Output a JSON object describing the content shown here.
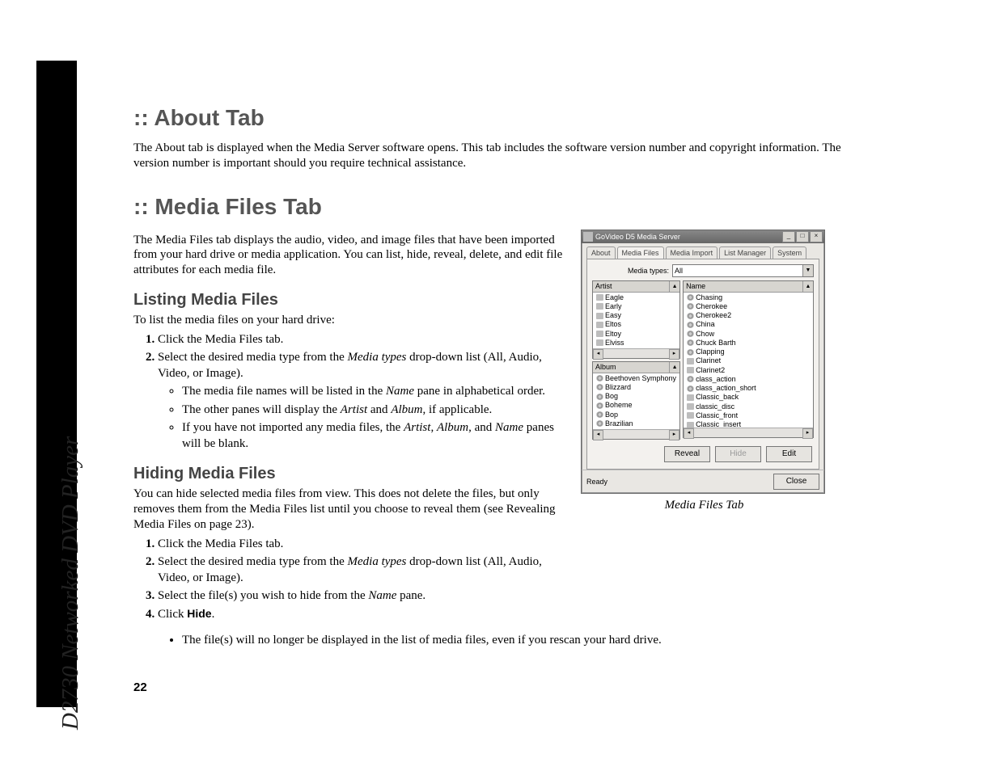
{
  "sidebar_title": "D2730 Networked DVD Player",
  "page_number": "22",
  "sections": {
    "about": {
      "heading": ":: About Tab",
      "paragraph": "The About tab is displayed when the Media Server software opens. This tab includes the software version number and copyright information. The version number is important should you require technical assistance."
    },
    "media_files": {
      "heading": ":: Media Files Tab",
      "intro": "The Media Files tab displays the audio, video, and image files that have been imported from your hard drive or media application. You can list, hide, reveal, delete, and edit file attributes for each media file.",
      "listing": {
        "heading": "Listing Media Files",
        "lead": "To list the media files on your hard drive:",
        "steps": [
          "Click the Media Files tab.",
          "Select the desired media type from the Media types drop-down list (All, Audio, Video, or Image)."
        ],
        "bullets": [
          "The media file names will be listed in the Name pane in alphabetical order.",
          "The other panes will display the Artist and Album, if applicable.",
          "If you have not imported any media files, the Artist, Album, and Name panes will be blank."
        ]
      },
      "hiding": {
        "heading": "Hiding Media Files",
        "lead": "You can hide selected media files from view. This does not delete the files, but only removes them from the Media Files list until you choose to reveal them (see Revealing Media Files on page 23).",
        "steps": [
          "Click the Media Files tab.",
          "Select the desired media type from the Media types drop-down list (All, Audio, Video, or Image).",
          "Select the file(s) you wish to hide from the Name pane.",
          "Click Hide."
        ],
        "bullet": "The file(s) will no longer be displayed in the list of media files, even if you rescan your hard drive."
      }
    }
  },
  "figure": {
    "caption": "Media Files Tab",
    "window": {
      "title": "GoVideo D5 Media Server",
      "tabs": [
        "About",
        "Media Files",
        "Media Import",
        "List Manager",
        "System"
      ],
      "active_tab": "Media Files",
      "media_types_label": "Media types:",
      "media_types_value": "All",
      "panes": {
        "artist": {
          "header": "Artist",
          "items": [
            "Eagle",
            "Early",
            "Easy",
            "Eltos",
            "Eltoy",
            "Elviss"
          ]
        },
        "album": {
          "header": "Album",
          "items": [
            "Beethoven Symphony",
            "Blizzard",
            "Bog",
            "Boheme",
            "Bop",
            "Brazilian"
          ]
        },
        "name": {
          "header": "Name",
          "items": [
            "Chasing",
            "Cherokee",
            "Cherokee2",
            "China",
            "Chow",
            "Chuck Barth",
            "Clapping",
            "Clarinet",
            "Clarinet2",
            "class_action",
            "class_action_short",
            "Classic_back",
            "classic_disc",
            "Classic_front",
            "Classic_insert"
          ]
        }
      },
      "buttons": {
        "reveal": "Reveal",
        "hide": "Hide",
        "edit": "Edit",
        "close": "Close"
      },
      "status": "Ready"
    }
  }
}
